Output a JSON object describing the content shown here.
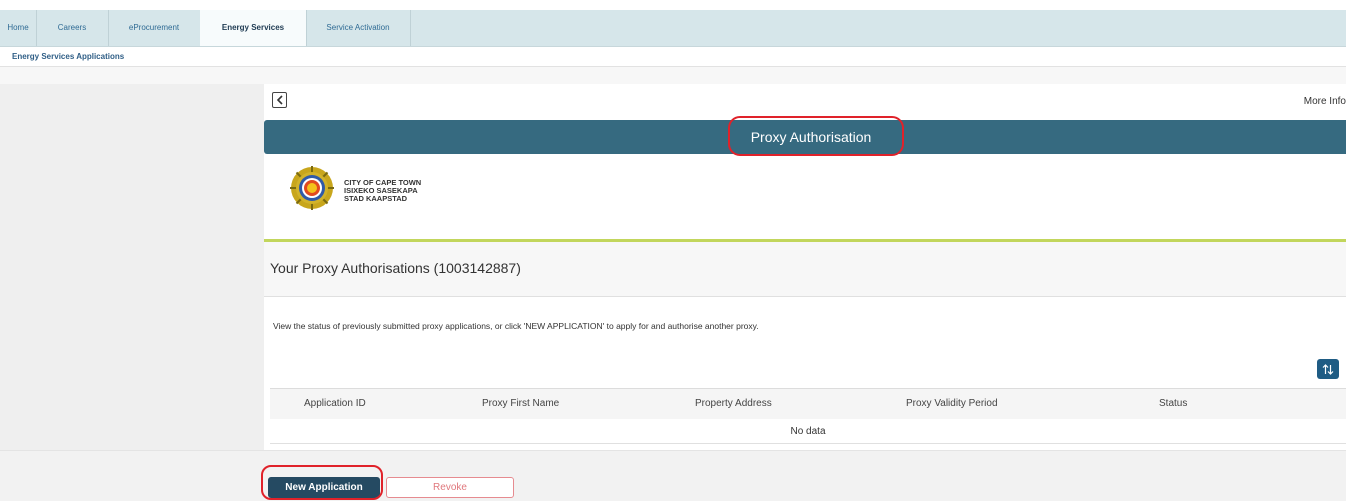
{
  "nav": {
    "tabs": [
      {
        "label": "Home"
      },
      {
        "label": "Careers"
      },
      {
        "label": "eProcurement"
      },
      {
        "label": "Energy Services"
      },
      {
        "label": "Service Activation"
      }
    ],
    "subnav_label": "Energy Services Applications"
  },
  "page": {
    "more_info": "More Info",
    "title": "Proxy Authorisation"
  },
  "logo": {
    "line1": "CITY OF CAPE TOWN",
    "line2": "ISIXEKO SASEKAPA",
    "line3": "STAD KAAPSTAD"
  },
  "section": {
    "heading": "Your Proxy Authorisations (1003142887)",
    "description": "View the status of previously submitted proxy applications, or click 'NEW APPLICATION' to apply for and authorise another proxy."
  },
  "table": {
    "columns": [
      "Application ID",
      "Proxy First Name",
      "Property Address",
      "Proxy Validity Period",
      "Status"
    ],
    "empty_text": "No data"
  },
  "actions": {
    "new_application": "New Application",
    "revoke": "Revoke"
  },
  "colors": {
    "title_bar": "#366a80",
    "accent_line": "#c2d65c",
    "primary_button": "#254a62",
    "highlight": "#e0222a"
  }
}
